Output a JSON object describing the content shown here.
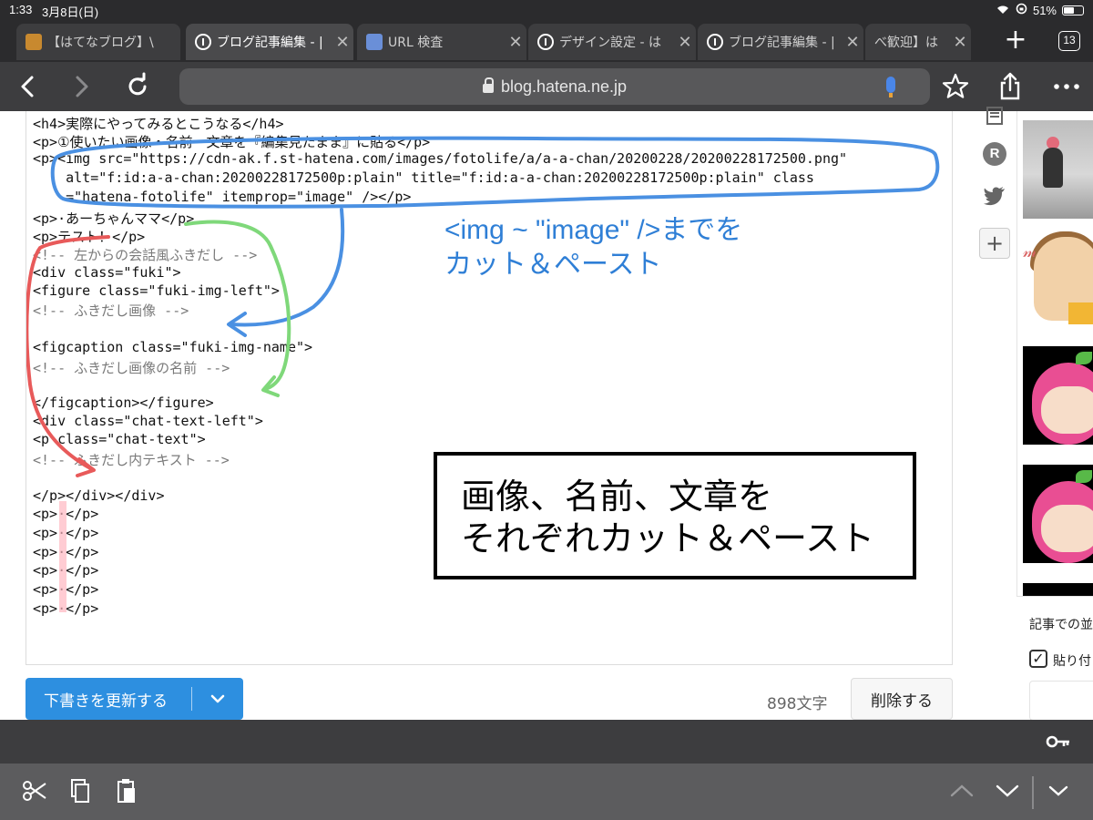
{
  "status_bar": {
    "time": "1:33",
    "date": "3月8日(日)",
    "battery": "51%"
  },
  "tabs": [
    {
      "label": "【はてなブログ】\\",
      "icon": "favicon-icon"
    },
    {
      "label": "ブログ記事編集 - |",
      "icon": "hatena-icon",
      "active": true
    },
    {
      "label": "URL 検査",
      "icon": "url-inspect-icon"
    },
    {
      "label": "デザイン設定 - は",
      "icon": "hatena-icon"
    },
    {
      "label": "ブログ記事編集 - |",
      "icon": "hatena-icon"
    },
    {
      "label": "べ歓迎】は",
      "icon": "hatena-icon"
    }
  ],
  "tab_count": "13",
  "url": "blog.hatena.ne.jp",
  "code_lines": [
    {
      "t": "<h4>実際にやってみるとこうなる</h4>"
    },
    {
      "t": "<p>①使いたい画像・名前・文章を『編集見たまま』に貼る</p>"
    },
    {
      "t": "<p><img src=\"https://cdn-ak.f.st-hatena.com/images/fotolife/a/a-a-chan/20200228/20200228172500.png\""
    },
    {
      "t": "    alt=\"f:id:a-a-chan:20200228172500p:plain\" title=\"f:id:a-a-chan:20200228172500p:plain\" class"
    },
    {
      "t": "    =\"hatena-fotolife\" itemprop=\"image\" /></p>"
    },
    {
      "t": "<p>·あーちゃんママ</p>"
    },
    {
      "t": "<p>テスト！</p>"
    },
    {
      "t": "<!-- 左からの会話風ふきだし -->"
    },
    {
      "t": "<div class=\"fuki\">"
    },
    {
      "t": "<figure class=\"fuki-img-left\">"
    },
    {
      "t": "<!-- ふきだし画像 -->"
    },
    {
      "t": ""
    },
    {
      "t": "<figcaption class=\"fuki-img-name\">"
    },
    {
      "t": "<!-- ふきだし画像の名前 -->"
    },
    {
      "t": ""
    },
    {
      "t": "</figcaption></figure>"
    },
    {
      "t": "<div class=\"chat-text-left\">"
    },
    {
      "t": "<p class=\"chat-text\">"
    },
    {
      "t": "<!-- ふきだし内テキスト -->"
    },
    {
      "t": ""
    },
    {
      "t": "</p></div></div>"
    },
    {
      "t": "<p>·</p>"
    },
    {
      "t": "<p>·</p>"
    },
    {
      "t": "<p>·</p>"
    },
    {
      "t": "<p>·</p>"
    },
    {
      "t": "<p>·</p>"
    },
    {
      "t": "<p>·</p>"
    }
  ],
  "annotations": {
    "blue_line1": "<img  ~  \"image\" />までを",
    "blue_line2": "カット＆ペースト",
    "box_line1": "画像、名前、文章を",
    "box_line2": "それぞれカット＆ペースト"
  },
  "sidebar_icons": [
    "document-icon",
    "r-icon",
    "twitter-icon",
    "plus-icon"
  ],
  "right_panel": {
    "text1": "記事での並",
    "checkbox_label": "貼り付",
    "checked": true
  },
  "actions": {
    "update_draft": "下書きを更新する",
    "char_count": "898文字",
    "delete": "削除する"
  },
  "colors": {
    "primary": "#2d8fe0",
    "annotation_blue": "#2f7fd6",
    "annotation_green": "#7fd87a",
    "annotation_red": "#e85a5a"
  }
}
